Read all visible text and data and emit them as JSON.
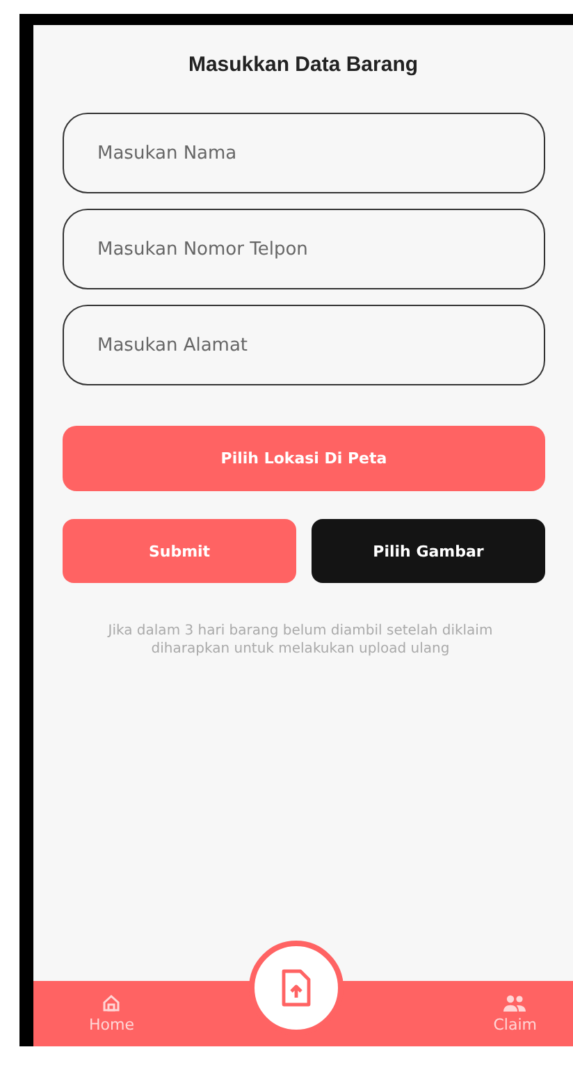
{
  "title": "Masukkan Data Barang",
  "fields": [
    {
      "placeholder": "Masukan Nama"
    },
    {
      "placeholder": "Masukan Nomor Telpon"
    },
    {
      "placeholder": "Masukan Alamat"
    }
  ],
  "map_button": {
    "label": "Pilih Lokasi Di Peta"
  },
  "actions": [
    {
      "label": "Submit",
      "kind": "primary"
    },
    {
      "label": "Pilih Gambar",
      "kind": "dark"
    }
  ],
  "note": "Jika dalam 3 hari barang belum diambil setelah diklaim diharapkan untuk melakukan upload ulang",
  "bottom_nav": {
    "items": [
      {
        "label": "Home",
        "kind": "home"
      },
      {
        "label": "Claim",
        "kind": "claim"
      }
    ]
  }
}
